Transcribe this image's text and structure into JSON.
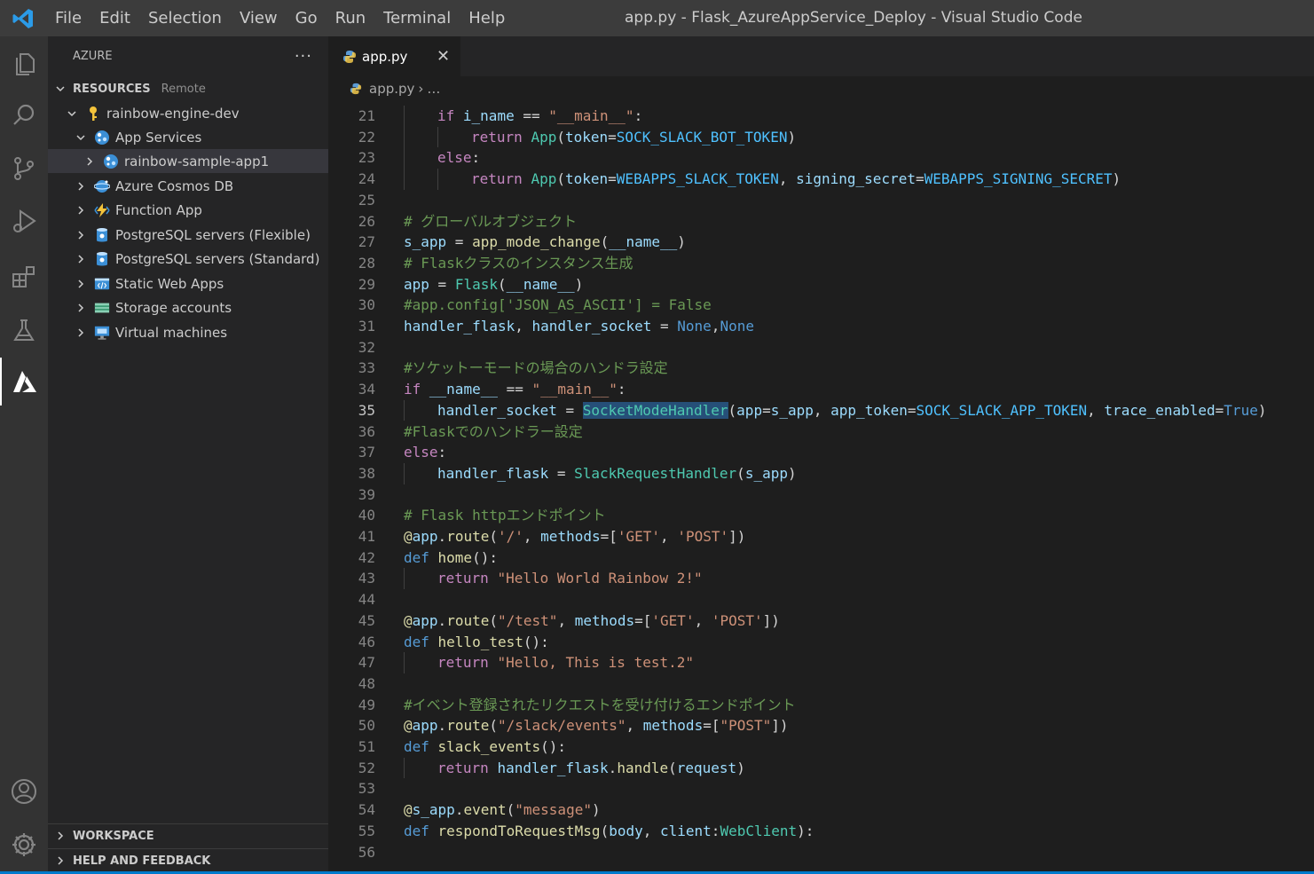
{
  "titlebar": {
    "menu": [
      "File",
      "Edit",
      "Selection",
      "View",
      "Go",
      "Run",
      "Terminal",
      "Help"
    ],
    "window_title": "app.py - Flask_AzureAppService_Deploy - Visual Studio Code"
  },
  "activitybar": {
    "icons": [
      "explorer-icon",
      "search-icon",
      "source-control-icon",
      "run-debug-icon",
      "extensions-icon",
      "testing-icon",
      "azure-icon",
      "accounts-icon",
      "manage-gear-icon"
    ],
    "active": "azure-icon"
  },
  "sidebar": {
    "title": "AZURE",
    "more": "···",
    "resources": {
      "label": "RESOURCES",
      "sublabel": "Remote",
      "subscription": "rainbow-engine-dev",
      "app_services": "App Services",
      "app_item": "rainbow-sample-app1",
      "groups": [
        "Azure Cosmos DB",
        "Function App",
        "PostgreSQL servers (Flexible)",
        "PostgreSQL servers (Standard)",
        "Static Web Apps",
        "Storage accounts",
        "Virtual machines"
      ]
    },
    "workspace_label": "WORKSPACE",
    "help_label": "HELP AND FEEDBACK"
  },
  "editor": {
    "tab_label": "app.py",
    "breadcrumb_file": "app.py",
    "breadcrumb_rest": "…",
    "current_line": 35,
    "lines": [
      {
        "n": "21",
        "indent": 1,
        "tokens": [
          [
            "kw",
            "if "
          ],
          [
            "var",
            "i_name"
          ],
          [
            "op",
            " == "
          ],
          [
            "str",
            "\"__main__\""
          ],
          [
            "op",
            ":"
          ]
        ]
      },
      {
        "n": "22",
        "indent": 2,
        "tokens": [
          [
            "kw",
            "return "
          ],
          [
            "cls",
            "App"
          ],
          [
            "op",
            "("
          ],
          [
            "var",
            "token"
          ],
          [
            "op",
            "="
          ],
          [
            "cst",
            "SOCK_SLACK_BOT_TOKEN"
          ],
          [
            "op",
            ")"
          ]
        ]
      },
      {
        "n": "23",
        "indent": 1,
        "tokens": [
          [
            "kw",
            "else"
          ],
          [
            "op",
            ":"
          ]
        ]
      },
      {
        "n": "24",
        "indent": 2,
        "tokens": [
          [
            "kw",
            "return "
          ],
          [
            "cls",
            "App"
          ],
          [
            "op",
            "("
          ],
          [
            "var",
            "token"
          ],
          [
            "op",
            "="
          ],
          [
            "cst",
            "WEBAPPS_SLACK_TOKEN"
          ],
          [
            "op",
            ", "
          ],
          [
            "var",
            "signing_secret"
          ],
          [
            "op",
            "="
          ],
          [
            "cst",
            "WEBAPPS_SIGNING_SECRET"
          ],
          [
            "op",
            ")"
          ]
        ]
      },
      {
        "n": "25",
        "indent": 0,
        "tokens": []
      },
      {
        "n": "26",
        "indent": 0,
        "tokens": [
          [
            "com",
            "# グローバルオブジェクト"
          ]
        ]
      },
      {
        "n": "27",
        "indent": 0,
        "tokens": [
          [
            "var",
            "s_app"
          ],
          [
            "op",
            " = "
          ],
          [
            "fn",
            "app_mode_change"
          ],
          [
            "op",
            "("
          ],
          [
            "var",
            "__name__"
          ],
          [
            "op",
            ")"
          ]
        ]
      },
      {
        "n": "28",
        "indent": 0,
        "tokens": [
          [
            "com",
            "# Flaskクラスのインスタンス生成"
          ]
        ]
      },
      {
        "n": "29",
        "indent": 0,
        "tokens": [
          [
            "var",
            "app"
          ],
          [
            "op",
            " = "
          ],
          [
            "cls",
            "Flask"
          ],
          [
            "op",
            "("
          ],
          [
            "var",
            "__name__"
          ],
          [
            "op",
            ")"
          ]
        ]
      },
      {
        "n": "30",
        "indent": 0,
        "tokens": [
          [
            "com",
            "#app.config['JSON_AS_ASCII'] = False"
          ]
        ]
      },
      {
        "n": "31",
        "indent": 0,
        "tokens": [
          [
            "var",
            "handler_flask"
          ],
          [
            "op",
            ", "
          ],
          [
            "var",
            "handler_socket"
          ],
          [
            "op",
            " = "
          ],
          [
            "kb",
            "None"
          ],
          [
            "op",
            ","
          ],
          [
            "kb",
            "None"
          ]
        ]
      },
      {
        "n": "32",
        "indent": 0,
        "tokens": []
      },
      {
        "n": "33",
        "indent": 0,
        "tokens": [
          [
            "com",
            "#ソケットーモードの場合のハンドラ設定"
          ]
        ]
      },
      {
        "n": "34",
        "indent": 0,
        "tokens": [
          [
            "kw",
            "if "
          ],
          [
            "var",
            "__name__"
          ],
          [
            "op",
            " == "
          ],
          [
            "str",
            "\"__main__\""
          ],
          [
            "op",
            ":"
          ]
        ]
      },
      {
        "n": "35",
        "indent": 1,
        "tokens": [
          [
            "var",
            "handler_socket"
          ],
          [
            "op",
            " = "
          ],
          [
            "cls hl",
            "SocketModeHandler"
          ],
          [
            "op",
            "("
          ],
          [
            "var",
            "app"
          ],
          [
            "op",
            "="
          ],
          [
            "var",
            "s_app"
          ],
          [
            "op",
            ", "
          ],
          [
            "var",
            "app_token"
          ],
          [
            "op",
            "="
          ],
          [
            "cst",
            "SOCK_SLACK_APP_TOKEN"
          ],
          [
            "op",
            ", "
          ],
          [
            "var",
            "trace_enabled"
          ],
          [
            "op",
            "="
          ],
          [
            "kb",
            "True"
          ],
          [
            "op",
            ")"
          ]
        ]
      },
      {
        "n": "36",
        "indent": 0,
        "tokens": [
          [
            "com",
            "#Flaskでのハンドラー設定"
          ]
        ]
      },
      {
        "n": "37",
        "indent": 0,
        "tokens": [
          [
            "kw",
            "else"
          ],
          [
            "op",
            ":"
          ]
        ]
      },
      {
        "n": "38",
        "indent": 1,
        "tokens": [
          [
            "var",
            "handler_flask"
          ],
          [
            "op",
            " = "
          ],
          [
            "cls",
            "SlackRequestHandler"
          ],
          [
            "op",
            "("
          ],
          [
            "var",
            "s_app"
          ],
          [
            "op",
            ")"
          ]
        ]
      },
      {
        "n": "39",
        "indent": 0,
        "tokens": []
      },
      {
        "n": "40",
        "indent": 0,
        "tokens": [
          [
            "com",
            "# Flask httpエンドポイント"
          ]
        ]
      },
      {
        "n": "41",
        "indent": 0,
        "tokens": [
          [
            "fn",
            "@"
          ],
          [
            "var",
            "app"
          ],
          [
            "op",
            "."
          ],
          [
            "fn",
            "route"
          ],
          [
            "op",
            "("
          ],
          [
            "str",
            "'/'"
          ],
          [
            "op",
            ", "
          ],
          [
            "var",
            "methods"
          ],
          [
            "op",
            "=["
          ],
          [
            "str",
            "'GET'"
          ],
          [
            "op",
            ", "
          ],
          [
            "str",
            "'POST'"
          ],
          [
            "op",
            "])"
          ]
        ]
      },
      {
        "n": "42",
        "indent": 0,
        "tokens": [
          [
            "kb",
            "def "
          ],
          [
            "fn",
            "home"
          ],
          [
            "op",
            "():"
          ]
        ]
      },
      {
        "n": "43",
        "indent": 1,
        "tokens": [
          [
            "kw",
            "return "
          ],
          [
            "str",
            "\"Hello World Rainbow 2!\""
          ]
        ]
      },
      {
        "n": "44",
        "indent": 0,
        "tokens": []
      },
      {
        "n": "45",
        "indent": 0,
        "tokens": [
          [
            "fn",
            "@"
          ],
          [
            "var",
            "app"
          ],
          [
            "op",
            "."
          ],
          [
            "fn",
            "route"
          ],
          [
            "op",
            "("
          ],
          [
            "str",
            "\"/test\""
          ],
          [
            "op",
            ", "
          ],
          [
            "var",
            "methods"
          ],
          [
            "op",
            "=["
          ],
          [
            "str",
            "'GET'"
          ],
          [
            "op",
            ", "
          ],
          [
            "str",
            "'POST'"
          ],
          [
            "op",
            "])"
          ]
        ]
      },
      {
        "n": "46",
        "indent": 0,
        "tokens": [
          [
            "kb",
            "def "
          ],
          [
            "fn",
            "hello_test"
          ],
          [
            "op",
            "():"
          ]
        ]
      },
      {
        "n": "47",
        "indent": 1,
        "tokens": [
          [
            "kw",
            "return "
          ],
          [
            "str",
            "\"Hello, This is test.2\""
          ]
        ]
      },
      {
        "n": "48",
        "indent": 0,
        "tokens": []
      },
      {
        "n": "49",
        "indent": 0,
        "tokens": [
          [
            "com",
            "#イベント登録されたリクエストを受け付けるエンドポイント"
          ]
        ]
      },
      {
        "n": "50",
        "indent": 0,
        "tokens": [
          [
            "fn",
            "@"
          ],
          [
            "var",
            "app"
          ],
          [
            "op",
            "."
          ],
          [
            "fn",
            "route"
          ],
          [
            "op",
            "("
          ],
          [
            "str",
            "\"/slack/events\""
          ],
          [
            "op",
            ", "
          ],
          [
            "var",
            "methods"
          ],
          [
            "op",
            "=["
          ],
          [
            "str",
            "\"POST\""
          ],
          [
            "op",
            "])"
          ]
        ]
      },
      {
        "n": "51",
        "indent": 0,
        "tokens": [
          [
            "kb",
            "def "
          ],
          [
            "fn",
            "slack_events"
          ],
          [
            "op",
            "():"
          ]
        ]
      },
      {
        "n": "52",
        "indent": 1,
        "tokens": [
          [
            "kw",
            "return "
          ],
          [
            "var",
            "handler_flask"
          ],
          [
            "op",
            "."
          ],
          [
            "fn",
            "handle"
          ],
          [
            "op",
            "("
          ],
          [
            "var",
            "request"
          ],
          [
            "op",
            ")"
          ]
        ]
      },
      {
        "n": "53",
        "indent": 0,
        "tokens": []
      },
      {
        "n": "54",
        "indent": 0,
        "tokens": [
          [
            "fn",
            "@"
          ],
          [
            "var",
            "s_app"
          ],
          [
            "op",
            "."
          ],
          [
            "fn",
            "event"
          ],
          [
            "op",
            "("
          ],
          [
            "str",
            "\"message\""
          ],
          [
            "op",
            ")"
          ]
        ]
      },
      {
        "n": "55",
        "indent": 0,
        "tokens": [
          [
            "kb",
            "def "
          ],
          [
            "fn",
            "respondToRequestMsg"
          ],
          [
            "op",
            "("
          ],
          [
            "var",
            "body"
          ],
          [
            "op",
            ", "
          ],
          [
            "var",
            "client"
          ],
          [
            "op",
            ":"
          ],
          [
            "cls",
            "WebClient"
          ],
          [
            "op",
            "):"
          ]
        ]
      },
      {
        "n": "56",
        "indent": 0,
        "tokens": []
      }
    ]
  }
}
